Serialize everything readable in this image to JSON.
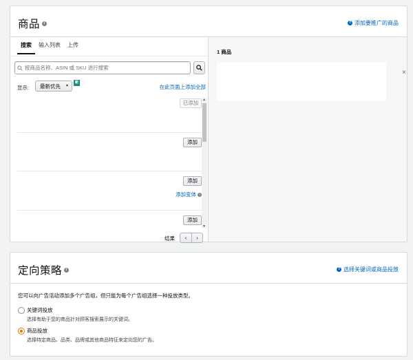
{
  "products": {
    "title": "商品",
    "help_link": "添加要推广的商品",
    "tabs": [
      {
        "label": "搜索"
      },
      {
        "label": "输入列表"
      },
      {
        "label": "上传"
      }
    ],
    "search": {
      "placeholder": "按商品名称、ASIN 或 SKU 进行搜索"
    },
    "show_label": "显示:",
    "sort_value": "最新优先",
    "new_badge": "新",
    "add_all": "在此页面上添加全部",
    "items": [
      {
        "button": "已添加"
      },
      {
        "button": "添加"
      },
      {
        "button": "添加",
        "variant_link": "添加变体"
      },
      {
        "button": "添加"
      }
    ],
    "results_label": "结果",
    "pager": {
      "prev": "‹",
      "next": "›"
    },
    "selected_count": "1 商品",
    "remove": "×"
  },
  "targeting": {
    "title": "定向策略",
    "help_link": "选择关键词或商品投放",
    "description": "您可以向广告活动添加多个广告组，但只能为每个广告组选择一种投放类型。",
    "options": [
      {
        "title": "关键词投放",
        "subtitle": "选择有助于您的商品针对顾客搜索展示的关键词。",
        "checked": false
      },
      {
        "title": "商品投放",
        "subtitle": "选择特定商品、品类、品牌或其他商品特征来定向您的广告。",
        "checked": true
      }
    ]
  },
  "colors": {
    "link": "#0066c0",
    "radio_checked": "#e77600",
    "badge": "#1e8a7c"
  }
}
